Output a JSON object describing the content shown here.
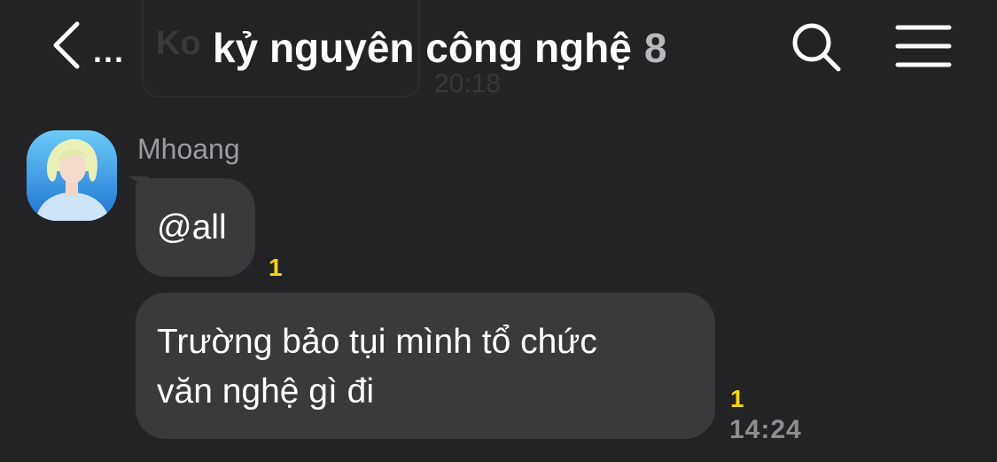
{
  "header": {
    "back_label": "...",
    "title": "kỷ nguyên công nghệ",
    "member_count": "8"
  },
  "background_ghost": {
    "preview_text": "Ko",
    "time": "20:18"
  },
  "message_group": {
    "sender": "Mhoang",
    "messages": [
      {
        "text": "@all",
        "unread_count": "1"
      },
      {
        "lines": [
          "Trường bảo tụi mình tổ chức",
          "văn nghệ gì đi"
        ],
        "unread_count": "1",
        "time": "14:24"
      }
    ]
  },
  "icons": {
    "back": "chevron-left-icon",
    "search": "search-icon",
    "menu": "hamburger-menu-icon",
    "avatar": "avatar"
  },
  "colors": {
    "background": "#232325",
    "bubble": "#3a3a3c",
    "unread": "#f5d512",
    "text": "#ffffff",
    "secondary_text": "#9b9ba0"
  }
}
